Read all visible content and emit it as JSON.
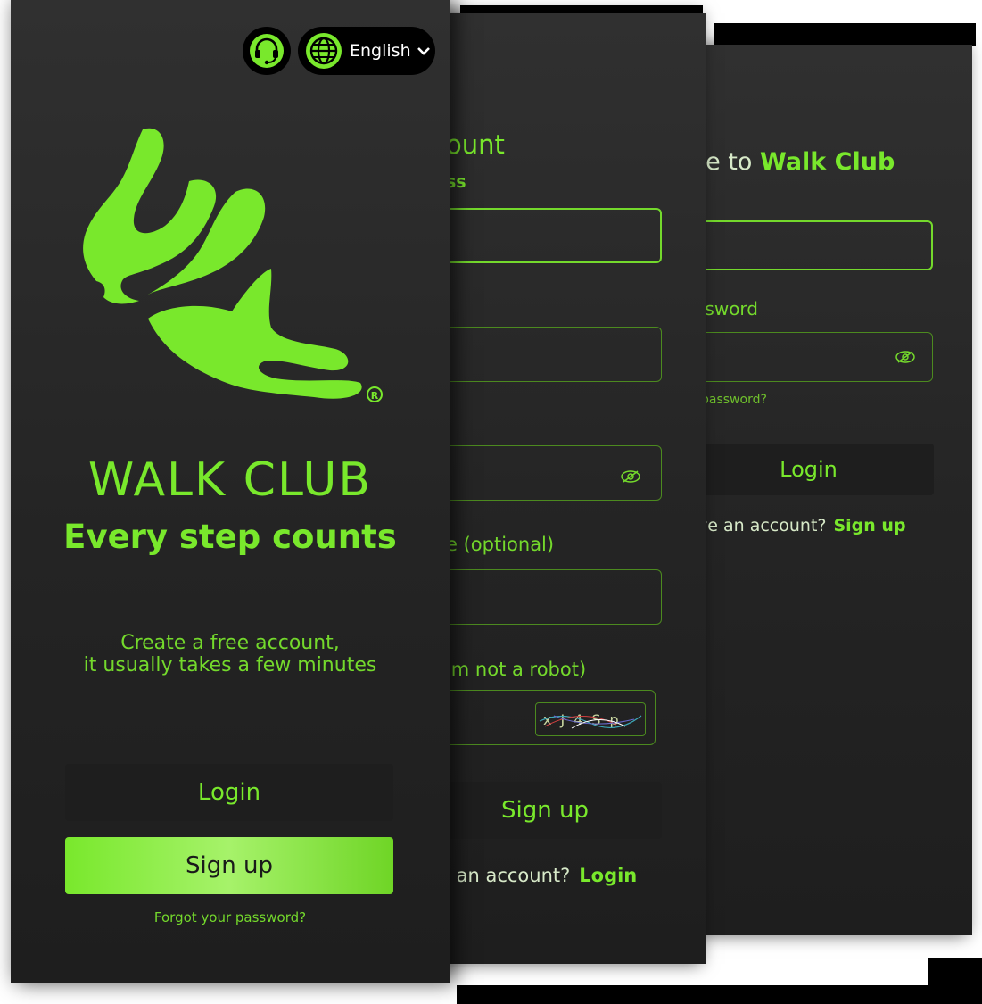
{
  "colors": {
    "accent": "#79e82c",
    "background": "#2a2a2a",
    "button_dark": "#1e1e1e"
  },
  "login_screen": {
    "title_prefix": "ne to",
    "title_brand": "Walk Club",
    "password_label": "ssword",
    "forgot_label": "password?",
    "login_label": "Login",
    "bottom_text": "ve an account?",
    "signup_link": "Sign up"
  },
  "signup_screen": {
    "title": "ount",
    "email_label": "ss",
    "optional_label": "e (optional)",
    "robot_label": "'m not a robot)",
    "captcha_text": "xJ4Sp",
    "signup_label": "Sign up",
    "bottom_text": "e an account?",
    "login_link": "Login"
  },
  "welcome_screen": {
    "support_icon": "headset-icon",
    "language_icon": "globe-icon",
    "language_label": "English",
    "registered_mark": "®",
    "brand_name": "WALK CLUB",
    "tagline": "Every step counts",
    "intro_line1": "Create a free account,",
    "intro_line2": "it usually takes a few minutes",
    "login_label": "Login",
    "signup_label": "Sign up",
    "forgot_label": "Forgot your password?"
  }
}
